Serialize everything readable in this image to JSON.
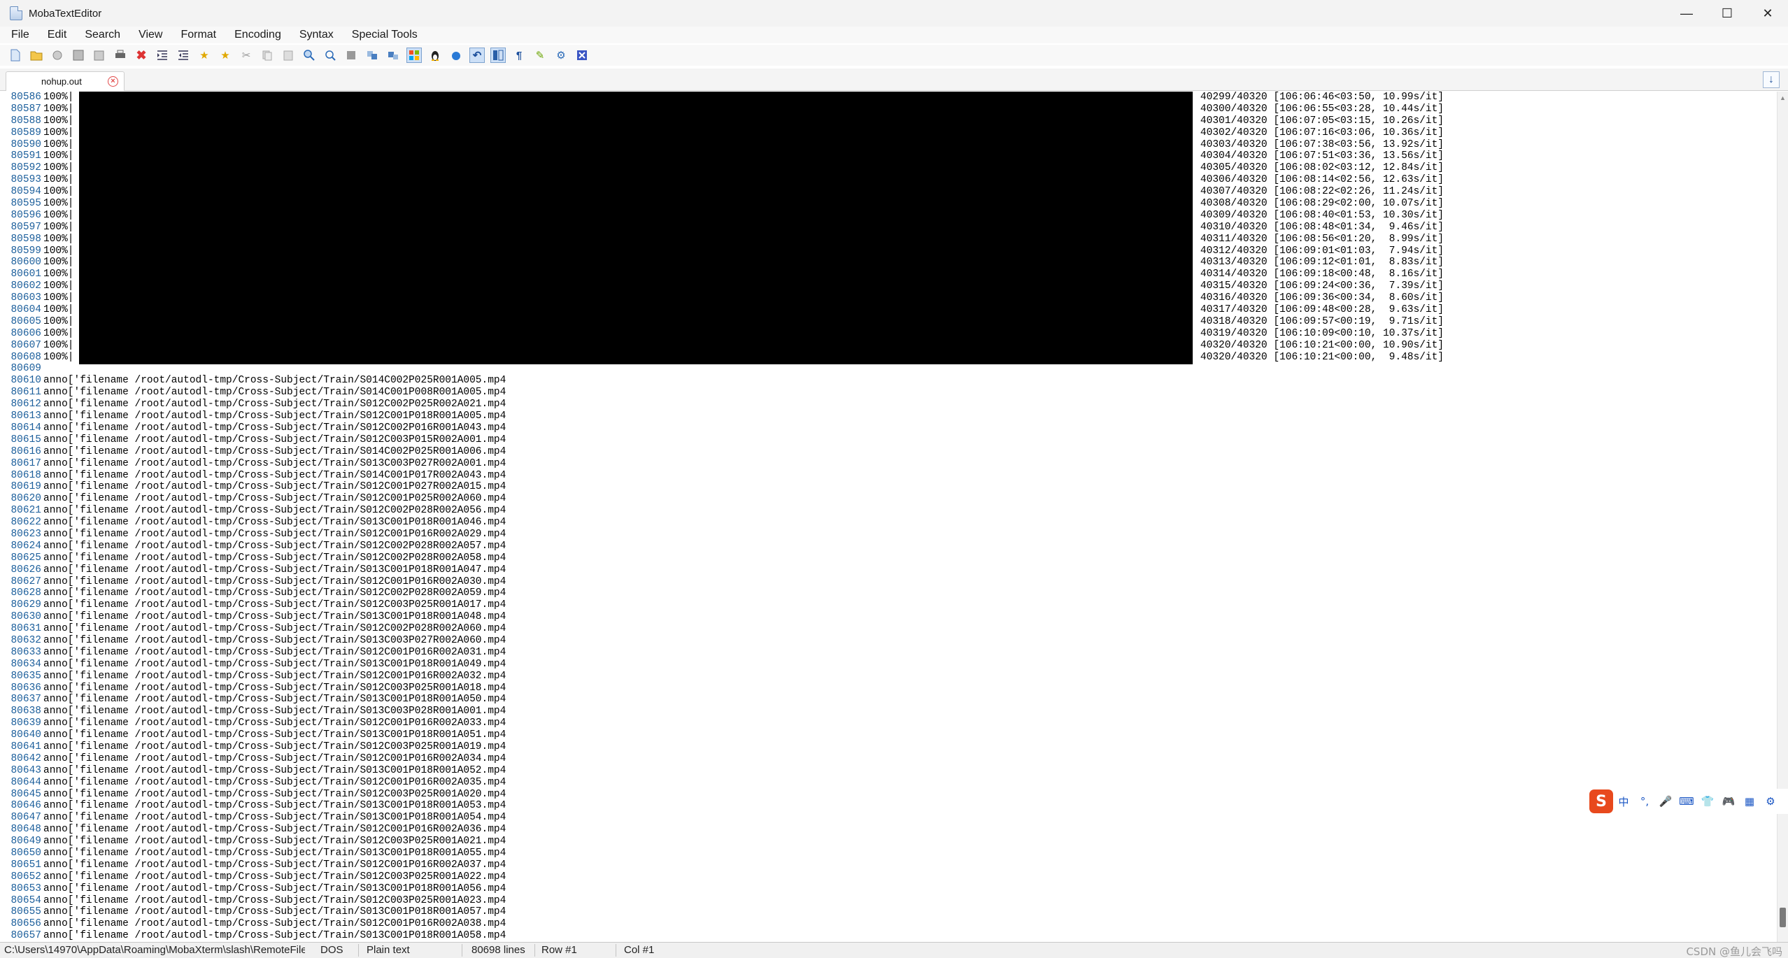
{
  "window": {
    "title": "MobaTextEditor"
  },
  "menu": [
    "File",
    "Edit",
    "Search",
    "View",
    "Format",
    "Encoding",
    "Syntax",
    "Special Tools"
  ],
  "toolbar_icons": [
    "new-file-icon",
    "open-folder-icon",
    "reload-icon",
    "save-icon",
    "save-as-icon",
    "print-icon",
    "close-file-icon",
    "indent-icon",
    "unindent-icon",
    "bookmark-icon",
    "bookmark-next-icon",
    "cut-icon",
    "copy-icon",
    "paste-icon",
    "find-icon",
    "find-replace-icon",
    "select-all-icon",
    "compare-icon",
    "split-icon",
    "windows-format-icon",
    "linux-format-icon",
    "mac-format-icon",
    "undo-icon",
    "split-view-icon",
    "pilcrow-icon",
    "highlight-icon",
    "settings-icon",
    "close-x-icon"
  ],
  "tab": {
    "label": "nohup.out"
  },
  "progress_lines": [
    {
      "n": "80586",
      "pre": "100%|",
      "post": "| 40299/40320 [106:06:46<03:50, 10.99s/it]"
    },
    {
      "n": "80587",
      "pre": "100%|",
      "post": "| 40300/40320 [106:06:55<03:28, 10.44s/it]"
    },
    {
      "n": "80588",
      "pre": "100%|",
      "post": "| 40301/40320 [106:07:05<03:15, 10.26s/it]"
    },
    {
      "n": "80589",
      "pre": "100%|",
      "post": "| 40302/40320 [106:07:16<03:06, 10.36s/it]"
    },
    {
      "n": "80590",
      "pre": "100%|",
      "post": "| 40303/40320 [106:07:38<03:56, 13.92s/it]"
    },
    {
      "n": "80591",
      "pre": "100%|",
      "post": "| 40304/40320 [106:07:51<03:36, 13.56s/it]"
    },
    {
      "n": "80592",
      "pre": "100%|",
      "post": "| 40305/40320 [106:08:02<03:12, 12.84s/it]"
    },
    {
      "n": "80593",
      "pre": "100%|",
      "post": "| 40306/40320 [106:08:14<02:56, 12.63s/it]"
    },
    {
      "n": "80594",
      "pre": "100%|",
      "post": "| 40307/40320 [106:08:22<02:26, 11.24s/it]"
    },
    {
      "n": "80595",
      "pre": "100%|",
      "post": "| 40308/40320 [106:08:29<02:00, 10.07s/it]"
    },
    {
      "n": "80596",
      "pre": "100%|",
      "post": "| 40309/40320 [106:08:40<01:53, 10.30s/it]"
    },
    {
      "n": "80597",
      "pre": "100%|",
      "post": "| 40310/40320 [106:08:48<01:34,  9.46s/it]"
    },
    {
      "n": "80598",
      "pre": "100%|",
      "post": "| 40311/40320 [106:08:56<01:20,  8.99s/it]"
    },
    {
      "n": "80599",
      "pre": "100%|",
      "post": "| 40312/40320 [106:09:01<01:03,  7.94s/it]"
    },
    {
      "n": "80600",
      "pre": "100%|",
      "post": "| 40313/40320 [106:09:12<01:01,  8.83s/it]"
    },
    {
      "n": "80601",
      "pre": "100%|",
      "post": "| 40314/40320 [106:09:18<00:48,  8.16s/it]"
    },
    {
      "n": "80602",
      "pre": "100%|",
      "post": "| 40315/40320 [106:09:24<00:36,  7.39s/it]"
    },
    {
      "n": "80603",
      "pre": "100%|",
      "post": "| 40316/40320 [106:09:36<00:34,  8.60s/it]"
    },
    {
      "n": "80604",
      "pre": "100%|",
      "post": "| 40317/40320 [106:09:48<00:28,  9.63s/it]"
    },
    {
      "n": "80605",
      "pre": "100%|",
      "post": "| 40318/40320 [106:09:57<00:19,  9.71s/it]"
    },
    {
      "n": "80606",
      "pre": "100%|",
      "post": "| 40319/40320 [106:10:09<00:10, 10.37s/it]"
    },
    {
      "n": "80607",
      "pre": "100%|",
      "post": "| 40320/40320 [106:10:21<00:00, 10.90s/it]"
    },
    {
      "n": "80608",
      "pre": "100%|",
      "post": "| 40320/40320 [106:10:21<00:00,  9.48s/it]"
    }
  ],
  "blank_line": "80609",
  "anno_lines": [
    {
      "n": "80610",
      "t": "anno['filename /root/autodl-tmp/Cross-Subject/Train/S014C002P025R001A005.mp4"
    },
    {
      "n": "80611",
      "t": "anno['filename /root/autodl-tmp/Cross-Subject/Train/S014C001P008R001A005.mp4"
    },
    {
      "n": "80612",
      "t": "anno['filename /root/autodl-tmp/Cross-Subject/Train/S012C002P025R002A021.mp4"
    },
    {
      "n": "80613",
      "t": "anno['filename /root/autodl-tmp/Cross-Subject/Train/S012C001P018R001A005.mp4"
    },
    {
      "n": "80614",
      "t": "anno['filename /root/autodl-tmp/Cross-Subject/Train/S012C002P016R001A043.mp4"
    },
    {
      "n": "80615",
      "t": "anno['filename /root/autodl-tmp/Cross-Subject/Train/S012C003P015R002A001.mp4"
    },
    {
      "n": "80616",
      "t": "anno['filename /root/autodl-tmp/Cross-Subject/Train/S014C002P025R001A006.mp4"
    },
    {
      "n": "80617",
      "t": "anno['filename /root/autodl-tmp/Cross-Subject/Train/S013C003P027R002A001.mp4"
    },
    {
      "n": "80618",
      "t": "anno['filename /root/autodl-tmp/Cross-Subject/Train/S014C001P017R002A043.mp4"
    },
    {
      "n": "80619",
      "t": "anno['filename /root/autodl-tmp/Cross-Subject/Train/S012C001P027R002A015.mp4"
    },
    {
      "n": "80620",
      "t": "anno['filename /root/autodl-tmp/Cross-Subject/Train/S012C001P025R002A060.mp4"
    },
    {
      "n": "80621",
      "t": "anno['filename /root/autodl-tmp/Cross-Subject/Train/S012C002P028R002A056.mp4"
    },
    {
      "n": "80622",
      "t": "anno['filename /root/autodl-tmp/Cross-Subject/Train/S013C001P018R001A046.mp4"
    },
    {
      "n": "80623",
      "t": "anno['filename /root/autodl-tmp/Cross-Subject/Train/S012C001P016R002A029.mp4"
    },
    {
      "n": "80624",
      "t": "anno['filename /root/autodl-tmp/Cross-Subject/Train/S012C002P028R002A057.mp4"
    },
    {
      "n": "80625",
      "t": "anno['filename /root/autodl-tmp/Cross-Subject/Train/S012C002P028R002A058.mp4"
    },
    {
      "n": "80626",
      "t": "anno['filename /root/autodl-tmp/Cross-Subject/Train/S013C001P018R001A047.mp4"
    },
    {
      "n": "80627",
      "t": "anno['filename /root/autodl-tmp/Cross-Subject/Train/S012C001P016R002A030.mp4"
    },
    {
      "n": "80628",
      "t": "anno['filename /root/autodl-tmp/Cross-Subject/Train/S012C002P028R002A059.mp4"
    },
    {
      "n": "80629",
      "t": "anno['filename /root/autodl-tmp/Cross-Subject/Train/S012C003P025R001A017.mp4"
    },
    {
      "n": "80630",
      "t": "anno['filename /root/autodl-tmp/Cross-Subject/Train/S013C001P018R001A048.mp4"
    },
    {
      "n": "80631",
      "t": "anno['filename /root/autodl-tmp/Cross-Subject/Train/S012C002P028R002A060.mp4"
    },
    {
      "n": "80632",
      "t": "anno['filename /root/autodl-tmp/Cross-Subject/Train/S013C003P027R002A060.mp4"
    },
    {
      "n": "80633",
      "t": "anno['filename /root/autodl-tmp/Cross-Subject/Train/S012C001P016R002A031.mp4"
    },
    {
      "n": "80634",
      "t": "anno['filename /root/autodl-tmp/Cross-Subject/Train/S013C001P018R001A049.mp4"
    },
    {
      "n": "80635",
      "t": "anno['filename /root/autodl-tmp/Cross-Subject/Train/S012C001P016R002A032.mp4"
    },
    {
      "n": "80636",
      "t": "anno['filename /root/autodl-tmp/Cross-Subject/Train/S012C003P025R001A018.mp4"
    },
    {
      "n": "80637",
      "t": "anno['filename /root/autodl-tmp/Cross-Subject/Train/S013C001P018R001A050.mp4"
    },
    {
      "n": "80638",
      "t": "anno['filename /root/autodl-tmp/Cross-Subject/Train/S013C003P028R001A001.mp4"
    },
    {
      "n": "80639",
      "t": "anno['filename /root/autodl-tmp/Cross-Subject/Train/S012C001P016R002A033.mp4"
    },
    {
      "n": "80640",
      "t": "anno['filename /root/autodl-tmp/Cross-Subject/Train/S013C001P018R001A051.mp4"
    },
    {
      "n": "80641",
      "t": "anno['filename /root/autodl-tmp/Cross-Subject/Train/S012C003P025R001A019.mp4"
    },
    {
      "n": "80642",
      "t": "anno['filename /root/autodl-tmp/Cross-Subject/Train/S012C001P016R002A034.mp4"
    },
    {
      "n": "80643",
      "t": "anno['filename /root/autodl-tmp/Cross-Subject/Train/S013C001P018R001A052.mp4"
    },
    {
      "n": "80644",
      "t": "anno['filename /root/autodl-tmp/Cross-Subject/Train/S012C001P016R002A035.mp4"
    },
    {
      "n": "80645",
      "t": "anno['filename /root/autodl-tmp/Cross-Subject/Train/S012C003P025R001A020.mp4"
    },
    {
      "n": "80646",
      "t": "anno['filename /root/autodl-tmp/Cross-Subject/Train/S013C001P018R001A053.mp4"
    },
    {
      "n": "80647",
      "t": "anno['filename /root/autodl-tmp/Cross-Subject/Train/S013C001P018R001A054.mp4"
    },
    {
      "n": "80648",
      "t": "anno['filename /root/autodl-tmp/Cross-Subject/Train/S012C001P016R002A036.mp4"
    },
    {
      "n": "80649",
      "t": "anno['filename /root/autodl-tmp/Cross-Subject/Train/S012C003P025R001A021.mp4"
    },
    {
      "n": "80650",
      "t": "anno['filename /root/autodl-tmp/Cross-Subject/Train/S013C001P018R001A055.mp4"
    },
    {
      "n": "80651",
      "t": "anno['filename /root/autodl-tmp/Cross-Subject/Train/S012C001P016R002A037.mp4"
    },
    {
      "n": "80652",
      "t": "anno['filename /root/autodl-tmp/Cross-Subject/Train/S012C003P025R001A022.mp4"
    },
    {
      "n": "80653",
      "t": "anno['filename /root/autodl-tmp/Cross-Subject/Train/S013C001P018R001A056.mp4"
    },
    {
      "n": "80654",
      "t": "anno['filename /root/autodl-tmp/Cross-Subject/Train/S012C003P025R001A023.mp4"
    },
    {
      "n": "80655",
      "t": "anno['filename /root/autodl-tmp/Cross-Subject/Train/S013C001P018R001A057.mp4"
    },
    {
      "n": "80656",
      "t": "anno['filename /root/autodl-tmp/Cross-Subject/Train/S012C001P016R002A038.mp4"
    },
    {
      "n": "80657",
      "t": "anno['filename /root/autodl-tmp/Cross-Subject/Train/S013C001P018R001A058.mp4"
    }
  ],
  "ime": {
    "logo": "S",
    "items": [
      "中",
      "°,",
      "🎤",
      "⌨",
      "👕",
      "🎮",
      "▦",
      "⚙"
    ]
  },
  "status": {
    "path": "C:\\Users\\14970\\AppData\\Roaming\\MobaXterm\\slash\\RemoteFiles",
    "format": "DOS",
    "syntax": "Plain text",
    "lines": "80698 lines",
    "row": "Row #1",
    "col": "Col #1",
    "watermark": "CSDN @鱼儿会飞吗"
  }
}
